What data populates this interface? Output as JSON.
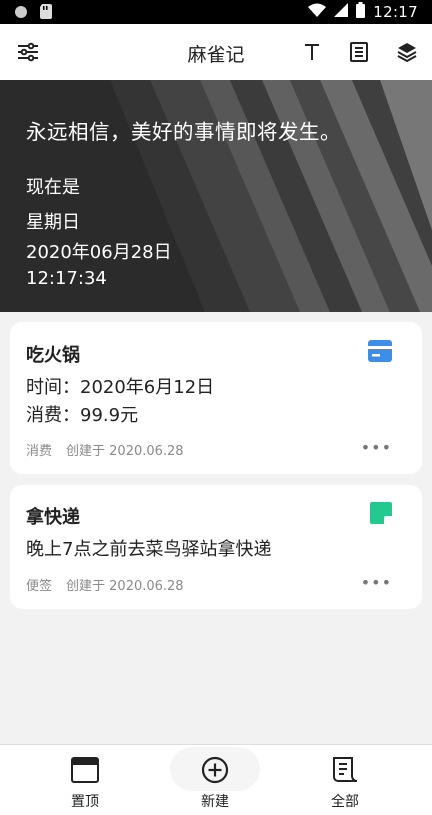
{
  "status_bar": {
    "time": "12:17"
  },
  "app_bar": {
    "title": "麻雀记"
  },
  "hero": {
    "quote": "永远相信，美好的事情即将发生。",
    "now_label": "现在是",
    "weekday": "星期日",
    "date": "2020年06月28日",
    "time": "12:17:34"
  },
  "cards": [
    {
      "title": "吃火锅",
      "lines": [
        "时间：2020年6月12日",
        "消费：99.9元"
      ],
      "category": "消费",
      "created": "创建于 2020.06.28",
      "more": "•••",
      "icon": "card-icon",
      "icon_color": "#3d8ee8"
    },
    {
      "title": "拿快递",
      "lines": [
        "晚上7点之前去菜鸟驿站拿快递"
      ],
      "category": "便签",
      "created": "创建于 2020.06.28",
      "more": "•••",
      "icon": "sticky-note-icon",
      "icon_color": "#23c98f"
    }
  ],
  "bottom_nav": [
    {
      "label": "置顶",
      "icon": "pin-top-icon"
    },
    {
      "label": "新建",
      "icon": "add-circle-icon"
    },
    {
      "label": "全部",
      "icon": "all-notes-icon"
    }
  ]
}
